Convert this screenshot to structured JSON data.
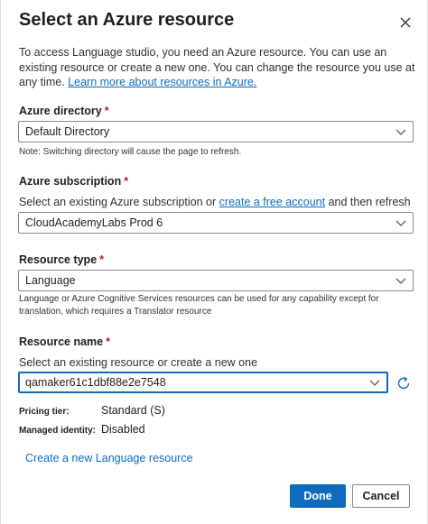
{
  "dialog": {
    "title": "Select an Azure resource",
    "close_icon": "close-icon",
    "intro_text": "To access Language studio, you need an Azure resource. You can use an existing resource or create a new one. You can change the resource you use at any time. ",
    "intro_link": "Learn more about resources in Azure."
  },
  "directory": {
    "label": "Azure directory",
    "required_mark": "*",
    "value": "Default Directory",
    "note": "Note: Switching directory will cause the page to refresh."
  },
  "subscription": {
    "label": "Azure subscription",
    "required_mark": "*",
    "helper_before": "Select an existing Azure subscription or ",
    "helper_link": "create a free account",
    "helper_after": " and then refresh",
    "value": "CloudAcademyLabs Prod 6"
  },
  "resource_type": {
    "label": "Resource type",
    "required_mark": "*",
    "value": "Language",
    "note": "Language or Azure Cognitive Services resources can be used for any capability except for translation, which requires a Translator resource"
  },
  "resource_name": {
    "label": "Resource name",
    "required_mark": "*",
    "helper": "Select an existing resource or create a new one",
    "value": "qamaker61c1dbf88e2e7548",
    "refresh_icon": "refresh-icon"
  },
  "details": {
    "pricing_tier_label": "Pricing tier:",
    "pricing_tier_value": "Standard (S)",
    "managed_identity_label": "Managed identity:",
    "managed_identity_value": "Disabled"
  },
  "create_link": "Create a new Language resource",
  "footer": {
    "done_label": "Done",
    "cancel_label": "Cancel"
  },
  "colors": {
    "accent": "#0f6cbd",
    "required": "#a4262c",
    "border": "#8a8886"
  }
}
